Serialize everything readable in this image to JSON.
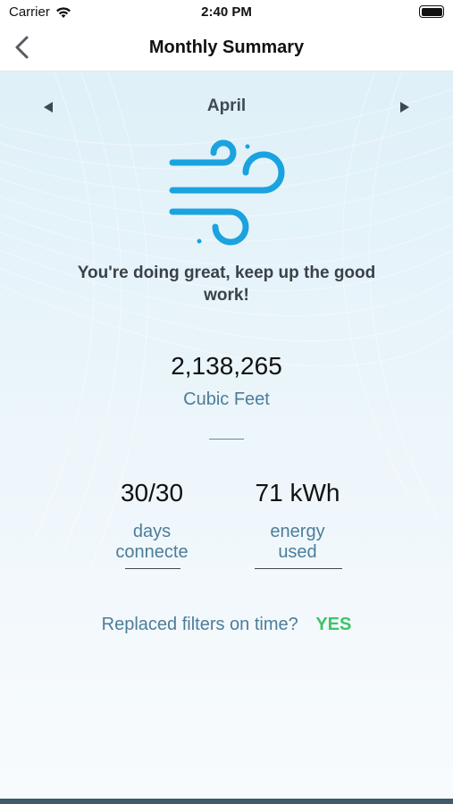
{
  "status_bar": {
    "carrier": "Carrier",
    "time": "2:40 PM",
    "icons": [
      "wifi-icon",
      "battery-icon"
    ]
  },
  "nav": {
    "title": "Monthly Summary",
    "back_icon": "chevron-left-icon"
  },
  "month_selector": {
    "month": "April",
    "prev_icon": "triangle-left-icon",
    "next_icon": "triangle-right-icon"
  },
  "summary": {
    "icon": "wind-icon",
    "message": "You're doing great, keep up the good work!",
    "volume_value": "2,138,265",
    "volume_unit": "Cubic Feet"
  },
  "stats": {
    "days_value": "30/30",
    "days_label_line1": "days",
    "days_label_line2": "connecte",
    "energy_value": "71 kWh",
    "energy_label_line1": "energy",
    "energy_label_line2": "used"
  },
  "filters": {
    "question": "Replaced filters on time?",
    "answer": "YES"
  },
  "colors": {
    "accent_blue": "#1aa3df",
    "label_blue": "#4c7d99",
    "success_green": "#3cc46a",
    "bottom_bar": "#3e5a6b"
  }
}
